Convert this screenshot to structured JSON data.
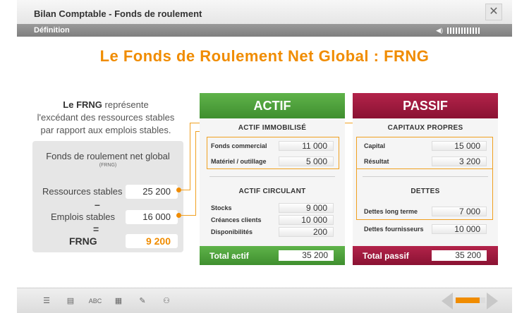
{
  "app": {
    "title": "Bilan Comptable - Fonds de roulement",
    "close_label": "✕",
    "section": "Définition"
  },
  "main": {
    "title": "Le Fonds de Roulement Net Global : FRNG",
    "desc_bold": "Le FRNG",
    "desc_line1": " représente",
    "desc_line2": "l'excédant des ressources stables",
    "desc_line3": "par rapport aux emplois stables."
  },
  "frng": {
    "heading": "Fonds de roulement net global",
    "sub": "(FRNG)",
    "ressources_label": "Ressources stables",
    "ressources_value": "25 200",
    "minus": "–",
    "emplois_label": "Emplois stables",
    "emplois_value": "16 000",
    "equals": "=",
    "result_label": "FRNG",
    "result_value": "9 200"
  },
  "actif": {
    "title": "ACTIF",
    "immobilise_title": "ACTIF IMMOBILISÉ",
    "rows_immo": [
      {
        "label": "Fonds commercial",
        "value": "11 000"
      },
      {
        "label": "Matériel / outillage",
        "value": "5 000"
      }
    ],
    "circulant_title": "ACTIF CIRCULANT",
    "rows_circ": [
      {
        "label": "Stocks",
        "value": "9 000"
      },
      {
        "label": "Créances clients",
        "value": "10 000"
      },
      {
        "label": "Disponibilités",
        "value": "200"
      }
    ],
    "total_label": "Total actif",
    "total_value": "35 200"
  },
  "passif": {
    "title": "PASSIF",
    "capitaux_title": "CAPITAUX PROPRES",
    "rows_cap": [
      {
        "label": "Capital",
        "value": "15 000"
      },
      {
        "label": "Résultat",
        "value": "3 200"
      }
    ],
    "dettes_title": "DETTES",
    "rows_dettes": [
      {
        "label": "Dettes long terme",
        "value": "7 000"
      },
      {
        "label": "Dettes fournisseurs",
        "value": "10 000"
      }
    ],
    "total_label": "Total passif",
    "total_value": "35 200"
  },
  "toolbar": {
    "icons": [
      "list-icon",
      "document-icon",
      "abc-icon",
      "calculator-icon",
      "edit-icon",
      "user-icon"
    ],
    "abc_label": "ABC"
  },
  "colors": {
    "accent": "#f08c00",
    "actif": "#4aa03a",
    "passif": "#a01a40"
  }
}
